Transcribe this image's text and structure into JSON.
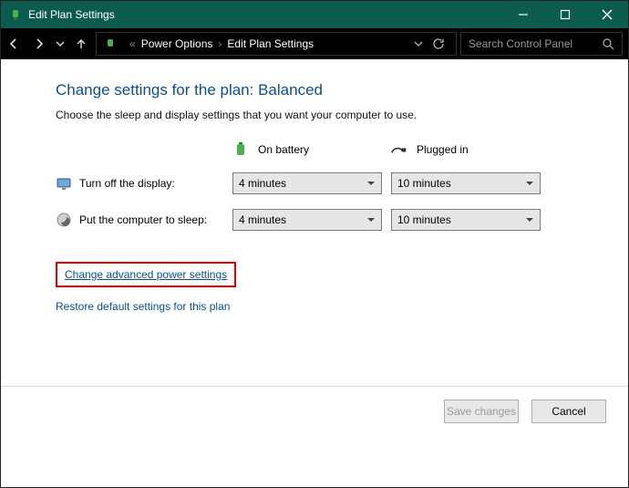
{
  "window": {
    "title": "Edit Plan Settings"
  },
  "breadcrumb": {
    "item1": "Power Options",
    "item2": "Edit Plan Settings"
  },
  "search": {
    "placeholder": "Search Control Panel"
  },
  "page": {
    "heading": "Change settings for the plan: Balanced",
    "subtitle": "Choose the sleep and display settings that you want your computer to use."
  },
  "columns": {
    "battery": "On battery",
    "plugged": "Plugged in"
  },
  "rows": {
    "display_label": "Turn off the display:",
    "sleep_label": "Put the computer to sleep:",
    "display_battery": "4 minutes",
    "display_plugged": "10 minutes",
    "sleep_battery": "4 minutes",
    "sleep_plugged": "10 minutes"
  },
  "links": {
    "advanced": "Change advanced power settings",
    "restore": "Restore default settings for this plan"
  },
  "buttons": {
    "save": "Save changes",
    "cancel": "Cancel"
  }
}
